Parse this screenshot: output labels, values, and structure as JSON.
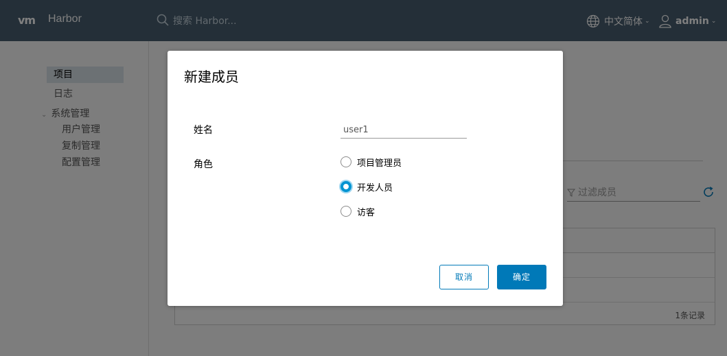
{
  "header": {
    "logo": "vm",
    "brand": "Harbor",
    "search_placeholder": "搜索 Harbor...",
    "language": "中文简体",
    "user": "admin"
  },
  "sidebar": {
    "items": [
      {
        "label": "项目",
        "active": true
      },
      {
        "label": "日志",
        "active": false
      }
    ],
    "group": {
      "label": "系统管理",
      "children": [
        "用户管理",
        "复制管理",
        "配置管理"
      ]
    }
  },
  "main": {
    "filter_placeholder": "过滤成员",
    "record_count": "1条记录"
  },
  "modal": {
    "title": "新建成员",
    "name_label": "姓名",
    "name_value": "user1",
    "role_label": "角色",
    "roles": [
      {
        "label": "项目管理员",
        "checked": false
      },
      {
        "label": "开发人员",
        "checked": true
      },
      {
        "label": "访客",
        "checked": false
      }
    ],
    "cancel_label": "取消",
    "ok_label": "确定"
  },
  "colors": {
    "header_bg": "#485f70",
    "primary": "#0079b8",
    "radio_checked": "#0094d2"
  }
}
